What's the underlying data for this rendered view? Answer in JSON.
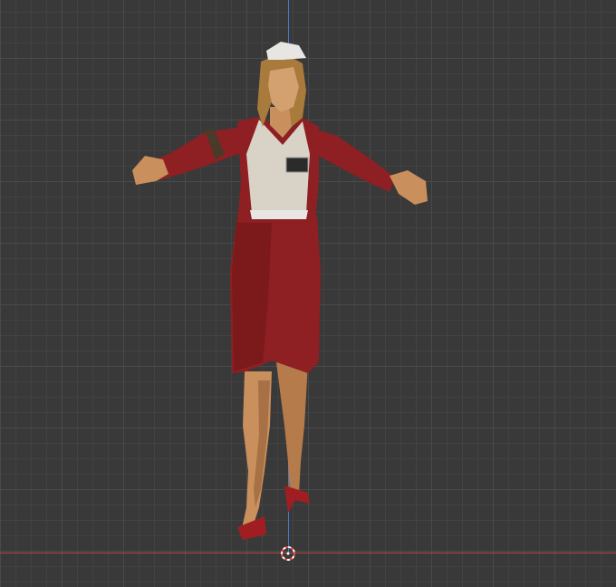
{
  "viewport": {
    "background_color": "#393939",
    "grid_major_color": "#4a4a4a",
    "grid_minor_color": "#424242",
    "axis_x_color": "#b0454a",
    "axis_y_color": "#4a78c9"
  },
  "model": {
    "subject": "character-model",
    "colors": {
      "uniform_red": "#8e1f22",
      "uniform_dark": "#5e1114",
      "blouse": "#d8d3c6",
      "skin": "#c98f5c",
      "skin_shade": "#8b5a33",
      "hair": "#a87a3c",
      "cap": "#e8e6e2",
      "shoes": "#a01e22"
    }
  },
  "cursor": {
    "icon": "3d-cursor-icon",
    "colors": [
      "#e94c3d",
      "#ffffff"
    ]
  }
}
